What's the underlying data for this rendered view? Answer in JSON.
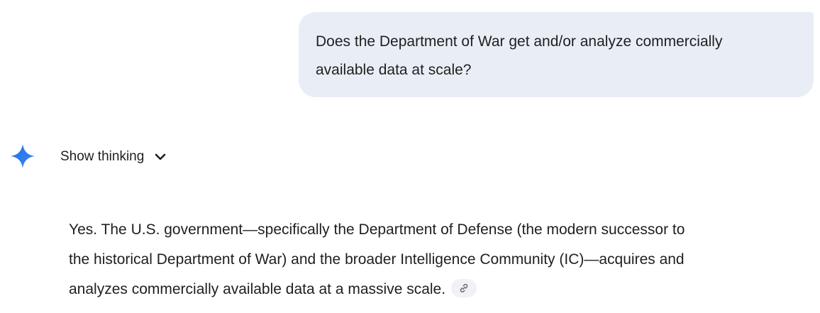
{
  "user_message": {
    "lines": [
      "Does the Department of War get and/or analyze commercially",
      "available data at scale?"
    ]
  },
  "response": {
    "assistant_icon": "gemini-sparkle-icon",
    "show_thinking_label": "Show thinking",
    "toggle_icon": "chevron-down-icon",
    "answer_lines": [
      "Yes. The U.S. government—specifically the Department of Defense (the modern successor to",
      "the historical Department of War) and the broader Intelligence Community (IC)—acquires and",
      "analyzes commercially available data at a massive scale."
    ],
    "source_link_icon": "link-icon"
  },
  "colors": {
    "user_bubble_bg": "#e9eef6",
    "gemini_blue": "#4285f4",
    "text": "#1f1f1f"
  }
}
